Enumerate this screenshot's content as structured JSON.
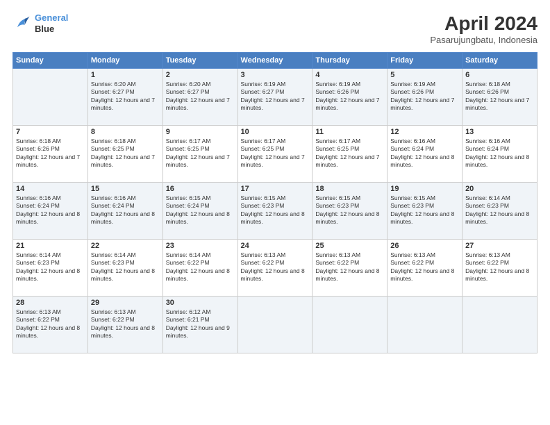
{
  "header": {
    "logo_line1": "General",
    "logo_line2": "Blue",
    "month": "April 2024",
    "location": "Pasarujungbatu, Indonesia"
  },
  "weekdays": [
    "Sunday",
    "Monday",
    "Tuesday",
    "Wednesday",
    "Thursday",
    "Friday",
    "Saturday"
  ],
  "weeks": [
    [
      null,
      {
        "day": "1",
        "sunrise": "6:20 AM",
        "sunset": "6:27 PM",
        "daylight": "12 hours and 7 minutes."
      },
      {
        "day": "2",
        "sunrise": "6:20 AM",
        "sunset": "6:27 PM",
        "daylight": "12 hours and 7 minutes."
      },
      {
        "day": "3",
        "sunrise": "6:19 AM",
        "sunset": "6:27 PM",
        "daylight": "12 hours and 7 minutes."
      },
      {
        "day": "4",
        "sunrise": "6:19 AM",
        "sunset": "6:26 PM",
        "daylight": "12 hours and 7 minutes."
      },
      {
        "day": "5",
        "sunrise": "6:19 AM",
        "sunset": "6:26 PM",
        "daylight": "12 hours and 7 minutes."
      },
      {
        "day": "6",
        "sunrise": "6:18 AM",
        "sunset": "6:26 PM",
        "daylight": "12 hours and 7 minutes."
      }
    ],
    [
      {
        "day": "7",
        "sunrise": "6:18 AM",
        "sunset": "6:26 PM",
        "daylight": "12 hours and 7 minutes."
      },
      {
        "day": "8",
        "sunrise": "6:18 AM",
        "sunset": "6:25 PM",
        "daylight": "12 hours and 7 minutes."
      },
      {
        "day": "9",
        "sunrise": "6:17 AM",
        "sunset": "6:25 PM",
        "daylight": "12 hours and 7 minutes."
      },
      {
        "day": "10",
        "sunrise": "6:17 AM",
        "sunset": "6:25 PM",
        "daylight": "12 hours and 7 minutes."
      },
      {
        "day": "11",
        "sunrise": "6:17 AM",
        "sunset": "6:25 PM",
        "daylight": "12 hours and 7 minutes."
      },
      {
        "day": "12",
        "sunrise": "6:16 AM",
        "sunset": "6:24 PM",
        "daylight": "12 hours and 8 minutes."
      },
      {
        "day": "13",
        "sunrise": "6:16 AM",
        "sunset": "6:24 PM",
        "daylight": "12 hours and 8 minutes."
      }
    ],
    [
      {
        "day": "14",
        "sunrise": "6:16 AM",
        "sunset": "6:24 PM",
        "daylight": "12 hours and 8 minutes."
      },
      {
        "day": "15",
        "sunrise": "6:16 AM",
        "sunset": "6:24 PM",
        "daylight": "12 hours and 8 minutes."
      },
      {
        "day": "16",
        "sunrise": "6:15 AM",
        "sunset": "6:24 PM",
        "daylight": "12 hours and 8 minutes."
      },
      {
        "day": "17",
        "sunrise": "6:15 AM",
        "sunset": "6:23 PM",
        "daylight": "12 hours and 8 minutes."
      },
      {
        "day": "18",
        "sunrise": "6:15 AM",
        "sunset": "6:23 PM",
        "daylight": "12 hours and 8 minutes."
      },
      {
        "day": "19",
        "sunrise": "6:15 AM",
        "sunset": "6:23 PM",
        "daylight": "12 hours and 8 minutes."
      },
      {
        "day": "20",
        "sunrise": "6:14 AM",
        "sunset": "6:23 PM",
        "daylight": "12 hours and 8 minutes."
      }
    ],
    [
      {
        "day": "21",
        "sunrise": "6:14 AM",
        "sunset": "6:23 PM",
        "daylight": "12 hours and 8 minutes."
      },
      {
        "day": "22",
        "sunrise": "6:14 AM",
        "sunset": "6:23 PM",
        "daylight": "12 hours and 8 minutes."
      },
      {
        "day": "23",
        "sunrise": "6:14 AM",
        "sunset": "6:22 PM",
        "daylight": "12 hours and 8 minutes."
      },
      {
        "day": "24",
        "sunrise": "6:13 AM",
        "sunset": "6:22 PM",
        "daylight": "12 hours and 8 minutes."
      },
      {
        "day": "25",
        "sunrise": "6:13 AM",
        "sunset": "6:22 PM",
        "daylight": "12 hours and 8 minutes."
      },
      {
        "day": "26",
        "sunrise": "6:13 AM",
        "sunset": "6:22 PM",
        "daylight": "12 hours and 8 minutes."
      },
      {
        "day": "27",
        "sunrise": "6:13 AM",
        "sunset": "6:22 PM",
        "daylight": "12 hours and 8 minutes."
      }
    ],
    [
      {
        "day": "28",
        "sunrise": "6:13 AM",
        "sunset": "6:22 PM",
        "daylight": "12 hours and 8 minutes."
      },
      {
        "day": "29",
        "sunrise": "6:13 AM",
        "sunset": "6:22 PM",
        "daylight": "12 hours and 8 minutes."
      },
      {
        "day": "30",
        "sunrise": "6:12 AM",
        "sunset": "6:21 PM",
        "daylight": "12 hours and 9 minutes."
      },
      null,
      null,
      null,
      null
    ]
  ]
}
